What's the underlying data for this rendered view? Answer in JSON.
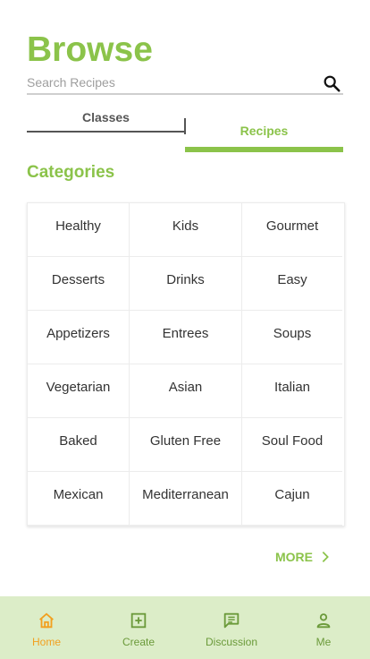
{
  "page": {
    "title": "Browse"
  },
  "search": {
    "placeholder": "Search Recipes",
    "icon": "search-icon"
  },
  "tabs": [
    {
      "label": "Classes",
      "active": false
    },
    {
      "label": "Recipes",
      "active": true
    }
  ],
  "categories": {
    "title": "Categories",
    "items": [
      "Healthy",
      "Kids",
      "Gourmet",
      "Desserts",
      "Drinks",
      "Easy",
      "Appetizers",
      "Entrees",
      "Soups",
      "Vegetarian",
      "Asian",
      "Italian",
      "Baked",
      "Gluten Free",
      "Soul Food",
      "Mexican",
      "Mediterranean",
      "Cajun"
    ]
  },
  "more": {
    "label": "MORE",
    "icon": "chevron-right-icon"
  },
  "bottom_nav": [
    {
      "label": "Home",
      "icon": "home-icon",
      "active": true
    },
    {
      "label": "Create",
      "icon": "add-box-icon",
      "active": false
    },
    {
      "label": "Discussion",
      "icon": "chat-icon",
      "active": false
    },
    {
      "label": "Me",
      "icon": "person-icon",
      "active": false
    }
  ],
  "colors": {
    "accent": "#8bc34a",
    "nav_background": "#dcedc8",
    "nav_active": "#f2a01f",
    "nav_inactive": "#6b9a3a"
  }
}
